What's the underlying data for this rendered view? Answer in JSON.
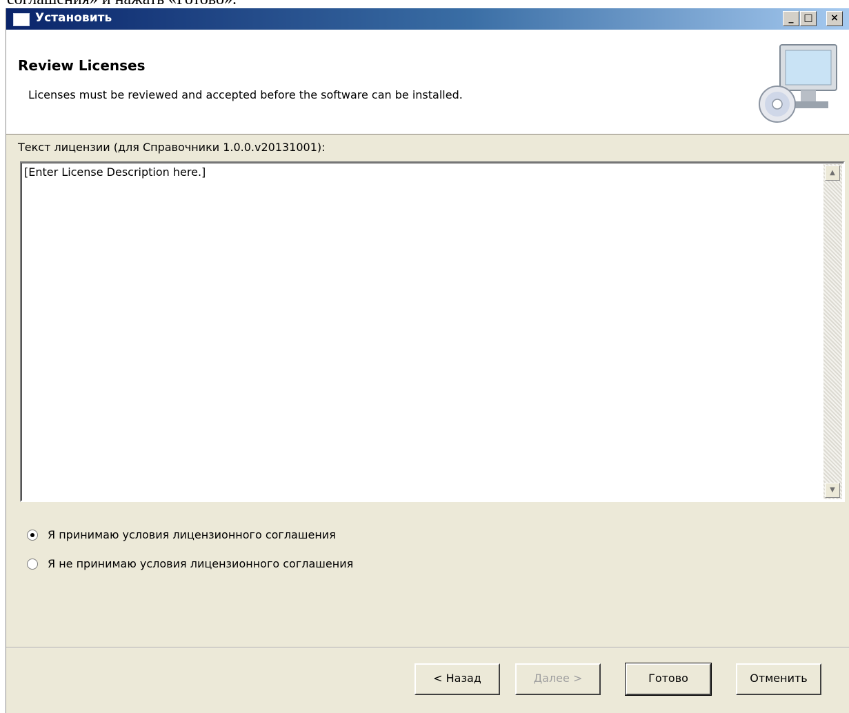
{
  "document": {
    "fragment_text": "соглашения» и нажать «Готово»."
  },
  "window": {
    "title": "Установить",
    "controls": {
      "minimize": "_",
      "maximize": "□",
      "close": "×"
    }
  },
  "banner": {
    "title": "Review Licenses",
    "description": "Licenses must be reviewed and accepted before the software can be installed.",
    "icon": "computer-cd-icon"
  },
  "license": {
    "label": "Текст лицензии (для Справочники 1.0.0.v20131001):",
    "text": "[Enter License Description here.]"
  },
  "options": {
    "accept": {
      "label": "Я принимаю условия лицензионного соглашения",
      "selected": true
    },
    "decline": {
      "label": "Я не принимаю условия лицензионного соглашения",
      "selected": false
    }
  },
  "buttons": {
    "back": "< Назад",
    "next": "Далее >",
    "finish": "Готово",
    "cancel": "Отменить"
  },
  "colors": {
    "titlebar_start": "#0a246a",
    "titlebar_end": "#a6caf0",
    "dialog_bg": "#ece9d8"
  }
}
